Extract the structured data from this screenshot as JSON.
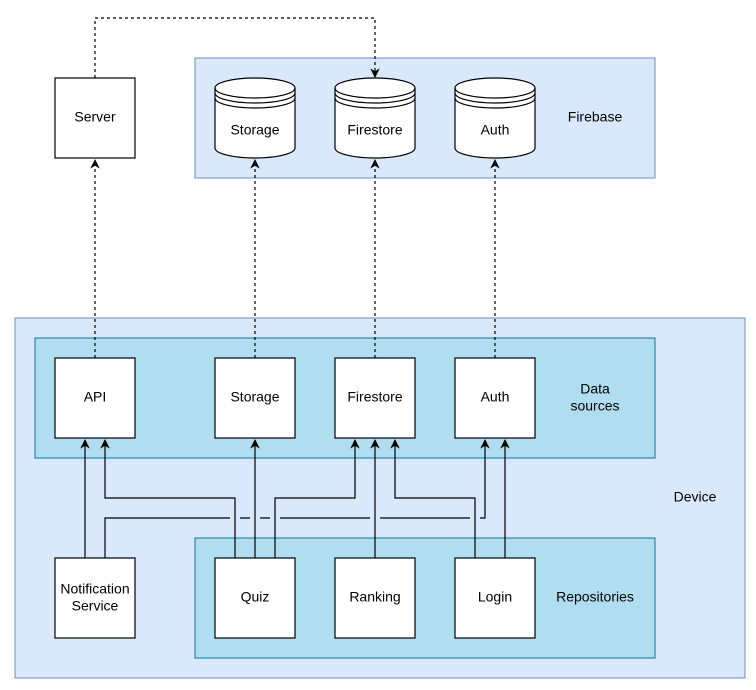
{
  "colors": {
    "outer_fill": "#dae8fc",
    "outer_stroke": "#6c8ebf",
    "inner_fill": "#b1ddf0",
    "inner_stroke": "#10739e"
  },
  "containers": {
    "firebase": "Firebase",
    "data_sources": [
      "Data",
      "sources"
    ],
    "device": "Device",
    "repositories": "Repositories"
  },
  "nodes": {
    "server": "Server",
    "fb_storage": "Storage",
    "fb_firestore": "Firestore",
    "fb_auth": "Auth",
    "api": "API",
    "ds_storage": "Storage",
    "ds_firestore": "Firestore",
    "ds_auth": "Auth",
    "notification": [
      "Notification",
      "Service"
    ],
    "quiz": "Quiz",
    "ranking": "Ranking",
    "login": "Login"
  }
}
